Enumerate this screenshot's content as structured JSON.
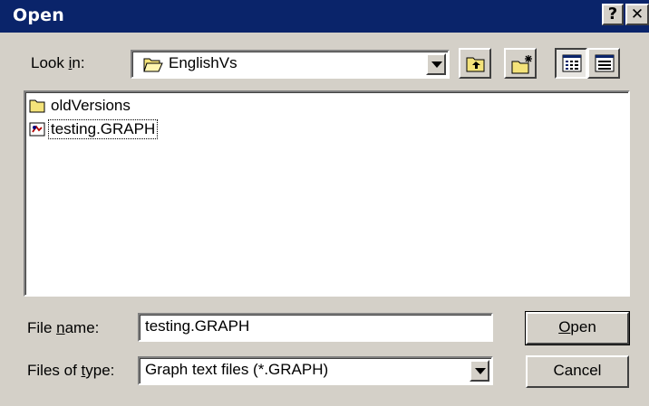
{
  "window": {
    "title": "Open",
    "help_glyph": "?",
    "close_glyph": "✕"
  },
  "look_in": {
    "label_pre": "Look ",
    "label_key": "i",
    "label_post": "n:",
    "value": "EnglishVs",
    "icon": "open-folder-icon"
  },
  "toolbar": [
    {
      "name": "up-one-level-button",
      "icon": "up-folder-icon"
    },
    {
      "name": "create-new-folder-button",
      "icon": "new-folder-icon"
    },
    {
      "name": "list-view-button",
      "icon": "list-view-icon",
      "pressed": true
    },
    {
      "name": "details-view-button",
      "icon": "details-view-icon",
      "pressed": false
    }
  ],
  "files": [
    {
      "name": "oldVersions",
      "type": "folder",
      "icon": "folder-icon"
    },
    {
      "name": "testing.GRAPH",
      "type": "file",
      "icon": "graph-file-icon",
      "focused": true
    }
  ],
  "file_name": {
    "label_pre": "File ",
    "label_key": "n",
    "label_post": "ame:",
    "value": "testing.GRAPH"
  },
  "file_type": {
    "label_pre": "Files of ",
    "label_key": "t",
    "label_post": "ype:",
    "value": "Graph text files (*.GRAPH)"
  },
  "buttons": {
    "open": {
      "key": "O",
      "rest": "pen"
    },
    "cancel": "Cancel"
  },
  "colors": {
    "titlebar": "#0a246a",
    "face": "#d4d0c8",
    "folder": "#f4e37a"
  }
}
